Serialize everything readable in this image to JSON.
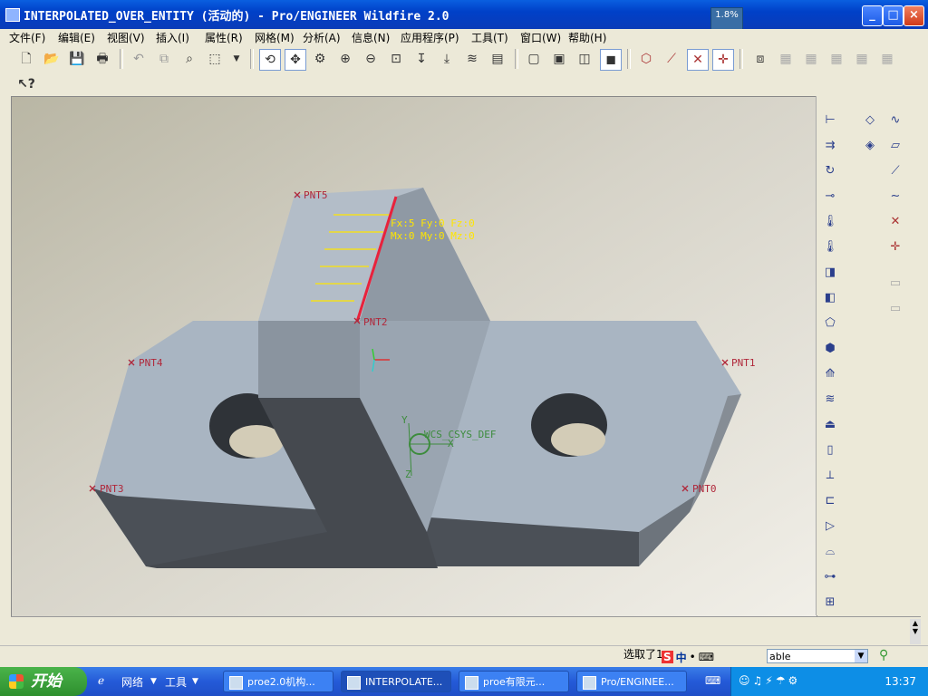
{
  "window": {
    "title": "INTERPOLATED_OVER_ENTITY (活动的) - Pro/ENGINEER Wildfire 2.0",
    "badge": "1.8%"
  },
  "menu": [
    "文件(F)",
    "编辑(E)",
    "视图(V)",
    "插入(I)",
    "属性(R)",
    "网格(M)",
    "分析(A)",
    "信息(N)",
    "应用程序(P)",
    "工具(T)",
    "窗口(W)",
    "帮助(H)"
  ],
  "model": {
    "points": [
      "PNT5",
      "PNT2",
      "PNT4",
      "PNT1",
      "PNT3",
      "PNT0"
    ],
    "load_label_line1": "Fx:5 Fy:0 Fz:0",
    "load_label_line2": "Mx:0 My:0 Mz:0",
    "csys_label": "WCS_CSYS_DEF",
    "axis_x": "X",
    "axis_y": "Y",
    "axis_z": "Z"
  },
  "status": {
    "message": "选取了1",
    "filter_value": "able",
    "ime_label": "中"
  },
  "taskbar": {
    "start_label": "开始",
    "quick_launch": [
      "网络",
      "工具"
    ],
    "tasks": [
      "proe2.0机构...",
      "INTERPOLATE...",
      "proe有限元...",
      "Pro/ENGINEE..."
    ],
    "clock": "13:37"
  },
  "colors": {
    "title_bar": "#0a5fe0",
    "load_edge": "#e8223c",
    "load_arrows": "#ffe600",
    "model_top": "#aab6c3",
    "model_dark": "#474c52",
    "csys": "#3d8c3d"
  }
}
